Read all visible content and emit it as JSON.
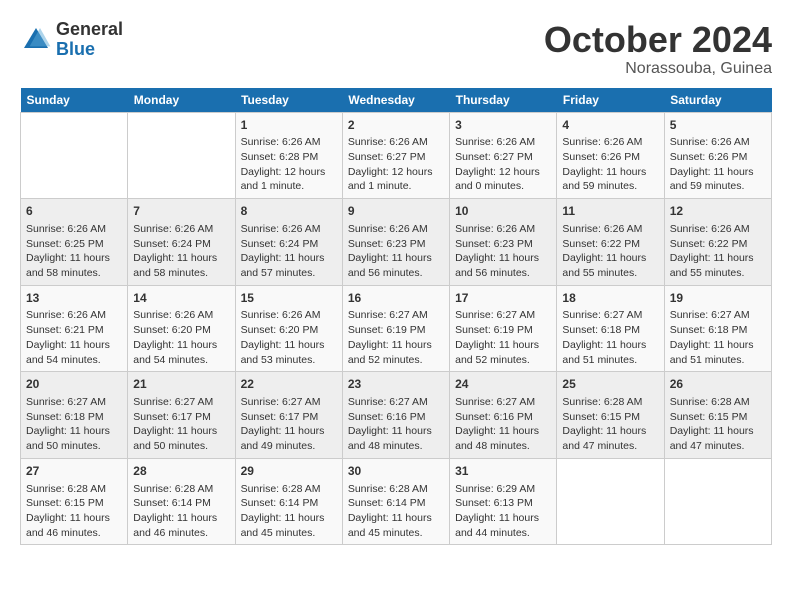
{
  "logo": {
    "general": "General",
    "blue": "Blue"
  },
  "title": "October 2024",
  "location": "Norassouba, Guinea",
  "headers": [
    "Sunday",
    "Monday",
    "Tuesday",
    "Wednesday",
    "Thursday",
    "Friday",
    "Saturday"
  ],
  "weeks": [
    [
      {
        "day": "",
        "content": ""
      },
      {
        "day": "",
        "content": ""
      },
      {
        "day": "1",
        "content": "Sunrise: 6:26 AM\nSunset: 6:28 PM\nDaylight: 12 hours\nand 1 minute."
      },
      {
        "day": "2",
        "content": "Sunrise: 6:26 AM\nSunset: 6:27 PM\nDaylight: 12 hours\nand 1 minute."
      },
      {
        "day": "3",
        "content": "Sunrise: 6:26 AM\nSunset: 6:27 PM\nDaylight: 12 hours\nand 0 minutes."
      },
      {
        "day": "4",
        "content": "Sunrise: 6:26 AM\nSunset: 6:26 PM\nDaylight: 11 hours\nand 59 minutes."
      },
      {
        "day": "5",
        "content": "Sunrise: 6:26 AM\nSunset: 6:26 PM\nDaylight: 11 hours\nand 59 minutes."
      }
    ],
    [
      {
        "day": "6",
        "content": "Sunrise: 6:26 AM\nSunset: 6:25 PM\nDaylight: 11 hours\nand 58 minutes."
      },
      {
        "day": "7",
        "content": "Sunrise: 6:26 AM\nSunset: 6:24 PM\nDaylight: 11 hours\nand 58 minutes."
      },
      {
        "day": "8",
        "content": "Sunrise: 6:26 AM\nSunset: 6:24 PM\nDaylight: 11 hours\nand 57 minutes."
      },
      {
        "day": "9",
        "content": "Sunrise: 6:26 AM\nSunset: 6:23 PM\nDaylight: 11 hours\nand 56 minutes."
      },
      {
        "day": "10",
        "content": "Sunrise: 6:26 AM\nSunset: 6:23 PM\nDaylight: 11 hours\nand 56 minutes."
      },
      {
        "day": "11",
        "content": "Sunrise: 6:26 AM\nSunset: 6:22 PM\nDaylight: 11 hours\nand 55 minutes."
      },
      {
        "day": "12",
        "content": "Sunrise: 6:26 AM\nSunset: 6:22 PM\nDaylight: 11 hours\nand 55 minutes."
      }
    ],
    [
      {
        "day": "13",
        "content": "Sunrise: 6:26 AM\nSunset: 6:21 PM\nDaylight: 11 hours\nand 54 minutes."
      },
      {
        "day": "14",
        "content": "Sunrise: 6:26 AM\nSunset: 6:20 PM\nDaylight: 11 hours\nand 54 minutes."
      },
      {
        "day": "15",
        "content": "Sunrise: 6:26 AM\nSunset: 6:20 PM\nDaylight: 11 hours\nand 53 minutes."
      },
      {
        "day": "16",
        "content": "Sunrise: 6:27 AM\nSunset: 6:19 PM\nDaylight: 11 hours\nand 52 minutes."
      },
      {
        "day": "17",
        "content": "Sunrise: 6:27 AM\nSunset: 6:19 PM\nDaylight: 11 hours\nand 52 minutes."
      },
      {
        "day": "18",
        "content": "Sunrise: 6:27 AM\nSunset: 6:18 PM\nDaylight: 11 hours\nand 51 minutes."
      },
      {
        "day": "19",
        "content": "Sunrise: 6:27 AM\nSunset: 6:18 PM\nDaylight: 11 hours\nand 51 minutes."
      }
    ],
    [
      {
        "day": "20",
        "content": "Sunrise: 6:27 AM\nSunset: 6:18 PM\nDaylight: 11 hours\nand 50 minutes."
      },
      {
        "day": "21",
        "content": "Sunrise: 6:27 AM\nSunset: 6:17 PM\nDaylight: 11 hours\nand 50 minutes."
      },
      {
        "day": "22",
        "content": "Sunrise: 6:27 AM\nSunset: 6:17 PM\nDaylight: 11 hours\nand 49 minutes."
      },
      {
        "day": "23",
        "content": "Sunrise: 6:27 AM\nSunset: 6:16 PM\nDaylight: 11 hours\nand 48 minutes."
      },
      {
        "day": "24",
        "content": "Sunrise: 6:27 AM\nSunset: 6:16 PM\nDaylight: 11 hours\nand 48 minutes."
      },
      {
        "day": "25",
        "content": "Sunrise: 6:28 AM\nSunset: 6:15 PM\nDaylight: 11 hours\nand 47 minutes."
      },
      {
        "day": "26",
        "content": "Sunrise: 6:28 AM\nSunset: 6:15 PM\nDaylight: 11 hours\nand 47 minutes."
      }
    ],
    [
      {
        "day": "27",
        "content": "Sunrise: 6:28 AM\nSunset: 6:15 PM\nDaylight: 11 hours\nand 46 minutes."
      },
      {
        "day": "28",
        "content": "Sunrise: 6:28 AM\nSunset: 6:14 PM\nDaylight: 11 hours\nand 46 minutes."
      },
      {
        "day": "29",
        "content": "Sunrise: 6:28 AM\nSunset: 6:14 PM\nDaylight: 11 hours\nand 45 minutes."
      },
      {
        "day": "30",
        "content": "Sunrise: 6:28 AM\nSunset: 6:14 PM\nDaylight: 11 hours\nand 45 minutes."
      },
      {
        "day": "31",
        "content": "Sunrise: 6:29 AM\nSunset: 6:13 PM\nDaylight: 11 hours\nand 44 minutes."
      },
      {
        "day": "",
        "content": ""
      },
      {
        "day": "",
        "content": ""
      }
    ]
  ]
}
